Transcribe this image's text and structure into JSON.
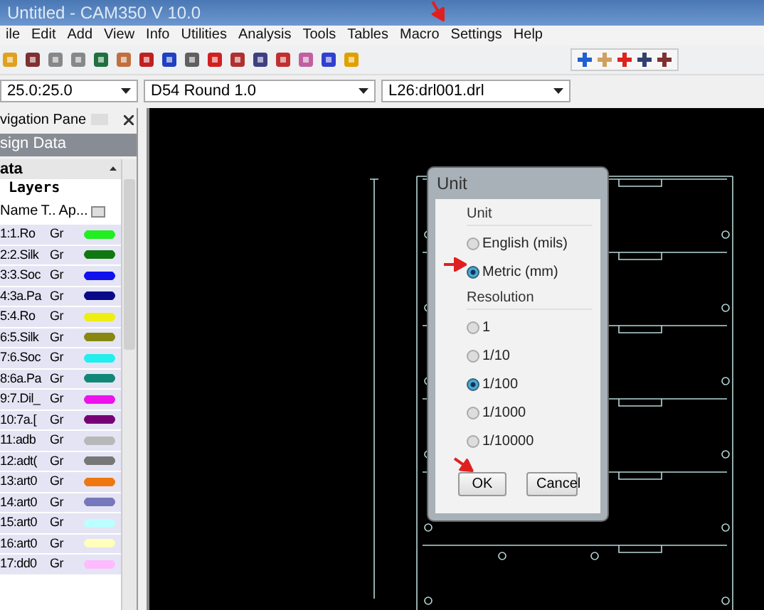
{
  "window": {
    "title": "Untitled - CAM350 V 10.0"
  },
  "menu": [
    "ile",
    "Edit",
    "Add",
    "View",
    "Info",
    "Utilities",
    "Analysis",
    "Tools",
    "Tables",
    "Macro",
    "Settings",
    "Help"
  ],
  "combos": [
    {
      "value": "25.0:25.0"
    },
    {
      "value": "D54  Round 1.0"
    },
    {
      "value": "L26:drl001.drl"
    }
  ],
  "navigation_pane": {
    "title": "vigation Pane",
    "section": "sign Data",
    "group": "ata",
    "subgroup": "Layers",
    "columns": [
      "Name",
      "T..",
      "Ap..."
    ],
    "layers": [
      {
        "name": "1:1.Ro",
        "type": "Gr",
        "color": "#22ee22"
      },
      {
        "name": "2:2.Silk",
        "type": "Gr",
        "color": "#117711"
      },
      {
        "name": "3:3.Soc",
        "type": "Gr",
        "color": "#1111ee"
      },
      {
        "name": "4:3a.Pa",
        "type": "Gr",
        "color": "#0a0a88"
      },
      {
        "name": "5:4.Ro",
        "type": "Gr",
        "color": "#eeee11"
      },
      {
        "name": "6:5.Silk",
        "type": "Gr",
        "color": "#888811"
      },
      {
        "name": "7:6.Soc",
        "type": "Gr",
        "color": "#22eeee"
      },
      {
        "name": "8:6a.Pa",
        "type": "Gr",
        "color": "#118877"
      },
      {
        "name": "9:7.Dil_",
        "type": "Gr",
        "color": "#ee11ee"
      },
      {
        "name": "10:7a.[",
        "type": "Gr",
        "color": "#770077"
      },
      {
        "name": "11:adb",
        "type": "Gr",
        "color": "#b8b8b8"
      },
      {
        "name": "12:adt(",
        "type": "Gr",
        "color": "#777777"
      },
      {
        "name": "13:art0",
        "type": "Gr",
        "color": "#ee7711"
      },
      {
        "name": "14:art0",
        "type": "Gr",
        "color": "#7777bb"
      },
      {
        "name": "15:art0",
        "type": "Gr",
        "color": "#bbffff"
      },
      {
        "name": "16:art0",
        "type": "Gr",
        "color": "#ffffbb"
      },
      {
        "name": "17:dd0",
        "type": "Gr",
        "color": "#ffbbff"
      }
    ]
  },
  "dialog": {
    "title": "Unit",
    "unit_label": "Unit",
    "units": [
      {
        "label": "English (mils)",
        "selected": false
      },
      {
        "label": "Metric (mm)",
        "selected": true
      }
    ],
    "resolution_label": "Resolution",
    "resolutions": [
      {
        "label": "1",
        "selected": false
      },
      {
        "label": "1/10",
        "selected": false
      },
      {
        "label": "1/100",
        "selected": true
      },
      {
        "label": "1/1000",
        "selected": false
      },
      {
        "label": "1/10000",
        "selected": false
      }
    ],
    "buttons": [
      "OK",
      "Cancel"
    ]
  }
}
